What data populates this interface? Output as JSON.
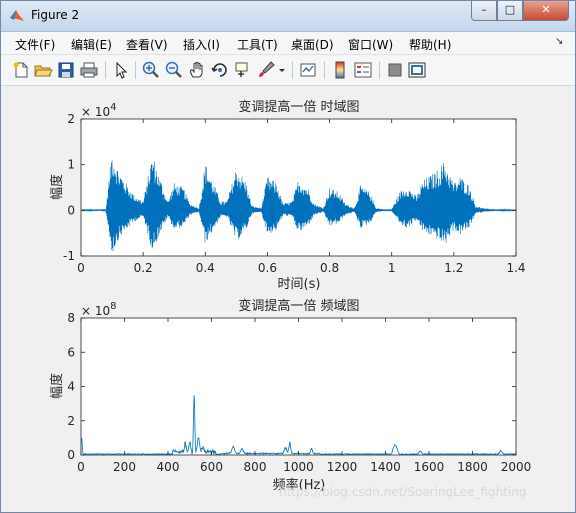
{
  "window": {
    "title": "Figure 2",
    "minimize": "–",
    "maximize": "□",
    "close": "✕"
  },
  "menu": [
    "文件(F)",
    "编辑(E)",
    "查看(V)",
    "插入(I)",
    "工具(T)",
    "桌面(D)",
    "窗口(W)",
    "帮助(H)"
  ],
  "menu_overflow": "↘",
  "toolbar": [
    "new-figure-icon",
    "open-icon",
    "save-icon",
    "print-icon",
    "pointer-icon",
    "zoom-in-icon",
    "zoom-out-icon",
    "pan-hand-icon",
    "rotate-3d-icon",
    "data-cursor-icon",
    "brush-icon",
    "link-plot-icon",
    "colorbar-icon",
    "legend-icon",
    "hide-plot-tools-icon",
    "show-plot-tools-icon"
  ],
  "colors": {
    "line": "#0072bd",
    "axes_bg": "#ffffff",
    "figure_bg": "#f0f0f0",
    "close_button": "#c74a33"
  },
  "chart_data": [
    {
      "type": "line",
      "title": "变调提高一倍 时域图",
      "xlabel": "时间(s)",
      "ylabel": "幅度",
      "exponent": "× 10^4",
      "exponent_base": "× 10",
      "exponent_power": "4",
      "xlim": [
        0,
        1.4
      ],
      "ylim": [
        -1,
        2
      ],
      "xticks": [
        "0",
        "0.2",
        "0.4",
        "0.6",
        "0.8",
        "1",
        "1.2",
        "1.4"
      ],
      "yticks": [
        "-1",
        "0",
        "1",
        "2"
      ],
      "envelope": {
        "t": [
          0.0,
          0.08,
          0.1,
          0.12,
          0.15,
          0.17,
          0.2,
          0.23,
          0.25,
          0.28,
          0.3,
          0.33,
          0.35,
          0.38,
          0.4,
          0.42,
          0.45,
          0.47,
          0.5,
          0.53,
          0.55,
          0.58,
          0.6,
          0.63,
          0.65,
          0.68,
          0.7,
          0.73,
          0.75,
          0.78,
          0.8,
          0.83,
          0.85,
          0.88,
          0.9,
          0.93,
          0.95,
          0.98,
          1.0,
          1.03,
          1.05,
          1.08,
          1.1,
          1.12,
          1.15,
          1.17,
          1.2,
          1.22,
          1.25,
          1.27,
          1.3,
          1.35,
          1.4
        ],
        "amp": [
          0.01,
          0.03,
          1.35,
          0.9,
          0.55,
          0.35,
          0.2,
          1.25,
          0.8,
          0.2,
          0.6,
          0.5,
          0.15,
          0.05,
          1.05,
          0.7,
          0.2,
          0.2,
          0.95,
          0.65,
          0.1,
          0.05,
          0.75,
          0.6,
          0.15,
          0.2,
          0.7,
          0.5,
          0.15,
          0.05,
          0.5,
          0.4,
          0.15,
          0.05,
          0.55,
          0.4,
          0.05,
          0.02,
          0.03,
          0.45,
          0.55,
          0.3,
          0.65,
          0.75,
          0.9,
          1.1,
          0.6,
          0.75,
          0.55,
          0.1,
          0.04,
          0.02,
          0.01
        ]
      }
    },
    {
      "type": "line",
      "title": "变调提高一倍 频域图",
      "xlabel": "频率(Hz)",
      "ylabel": "幅度",
      "exponent": "× 10^8",
      "exponent_base": "× 10",
      "exponent_power": "8",
      "xlim": [
        0,
        2000
      ],
      "ylim": [
        0,
        8
      ],
      "xticks": [
        "0",
        "200",
        "400",
        "600",
        "800",
        "1000",
        "1200",
        "1400",
        "1600",
        "1800",
        "2000"
      ],
      "yticks": [
        "0",
        "2",
        "4",
        "6",
        "8"
      ],
      "peaks": [
        {
          "f": 2,
          "a": 1.2,
          "w": 4
        },
        {
          "f": 480,
          "a": 0.6,
          "w": 6
        },
        {
          "f": 500,
          "a": 0.8,
          "w": 5
        },
        {
          "f": 520,
          "a": 4.0,
          "w": 4
        },
        {
          "f": 540,
          "a": 0.9,
          "w": 6
        },
        {
          "f": 560,
          "a": 0.4,
          "w": 6
        },
        {
          "f": 700,
          "a": 0.5,
          "w": 8
        },
        {
          "f": 740,
          "a": 0.3,
          "w": 8
        },
        {
          "f": 940,
          "a": 0.4,
          "w": 8
        },
        {
          "f": 960,
          "a": 0.7,
          "w": 6
        },
        {
          "f": 1060,
          "a": 0.3,
          "w": 6
        },
        {
          "f": 1440,
          "a": 0.5,
          "w": 8
        },
        {
          "f": 1450,
          "a": 0.4,
          "w": 8
        },
        {
          "f": 1560,
          "a": 0.2,
          "w": 8
        },
        {
          "f": 1930,
          "a": 0.2,
          "w": 8
        }
      ]
    }
  ],
  "watermark": "https://blog.csdn.net/SoaringLee_fighting"
}
